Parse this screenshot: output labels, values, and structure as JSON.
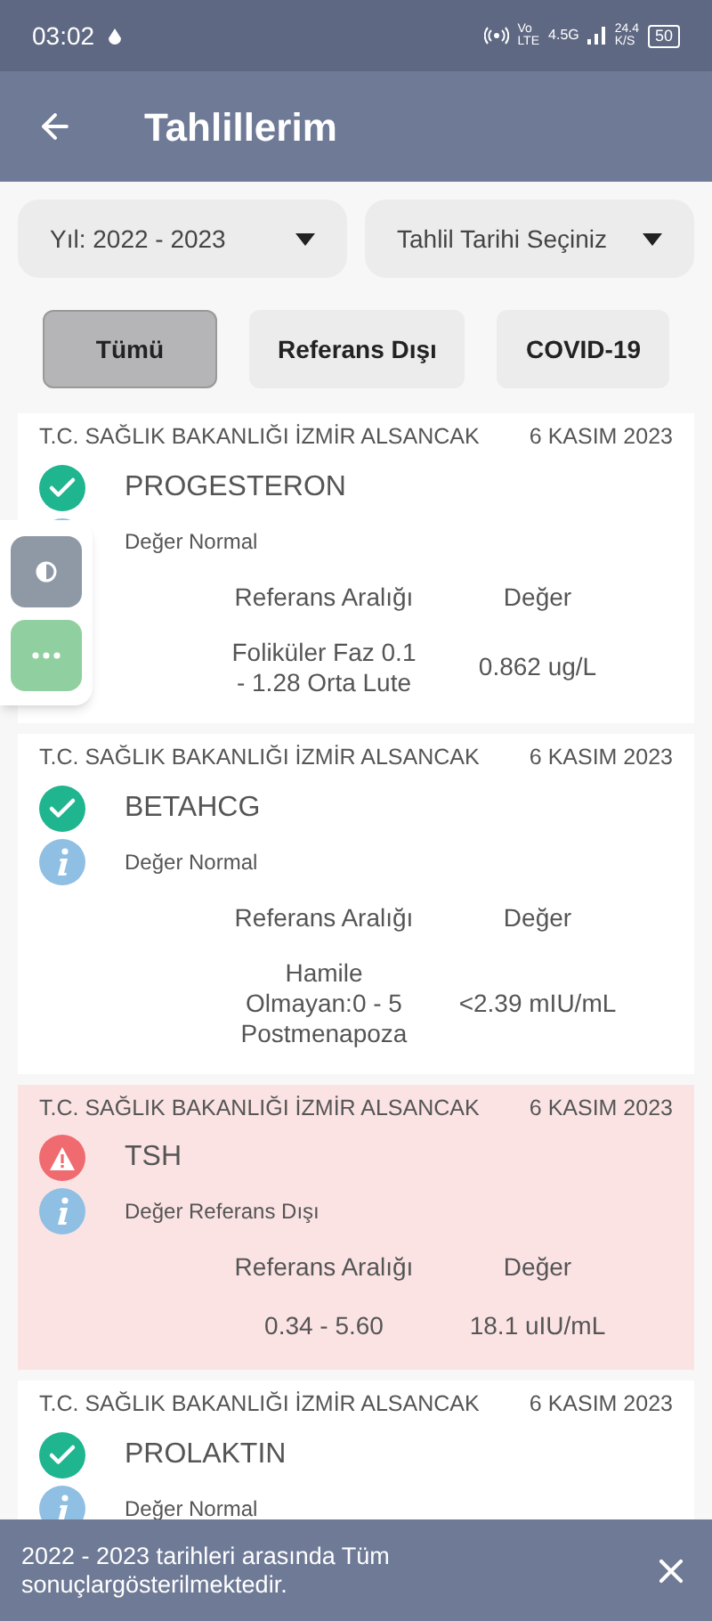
{
  "status_bar": {
    "time": "03:02",
    "volte_top": "Vo",
    "volte_bottom": "LTE",
    "network": "4.5G",
    "speed": "24.4",
    "speed_unit": "K/S",
    "battery": "50"
  },
  "header": {
    "title": "Tahlillerim"
  },
  "filters": [
    {
      "label": "Yıl: 2022 - 2023"
    },
    {
      "label": "Tahlil Tarihi Seçiniz"
    }
  ],
  "tabs": [
    {
      "label": "Tümü",
      "selected": true
    },
    {
      "label": "Referans Dışı",
      "selected": false
    },
    {
      "label": "COVID-19",
      "selected": false
    }
  ],
  "results": [
    {
      "source": "T.C. SAĞLIK BAKANLIĞI İZMİR ALSANCAK",
      "date": "6 KASIM 2023",
      "kind": "normal",
      "name": "PROGESTERON",
      "status": "Değer Normal",
      "range_header": "Referans Aralığı",
      "value_header": "Değer",
      "range": "Foliküler Faz 0.1 - 1.28 Orta Lute",
      "value": "0.862 ug/L"
    },
    {
      "source": "T.C. SAĞLIK BAKANLIĞI İZMİR ALSANCAK",
      "date": "6 KASIM 2023",
      "kind": "normal",
      "name": "BETAHCG",
      "status": "Değer Normal",
      "range_header": "Referans Aralığı",
      "value_header": "Değer",
      "range": "Hamile Olmayan:0 - 5 Postmenapoza",
      "value": "<2.39 mIU/mL"
    },
    {
      "source": "T.C. SAĞLIK BAKANLIĞI İZMİR ALSANCAK",
      "date": "6 KASIM 2023",
      "kind": "out_of_range",
      "name": "TSH",
      "status": "Değer Referans Dışı",
      "range_header": "Referans Aralığı",
      "value_header": "Değer",
      "range": "0.34 - 5.60",
      "value": "18.1 uIU/mL"
    },
    {
      "source": "T.C. SAĞLIK BAKANLIĞI İZMİR ALSANCAK",
      "date": "6 KASIM 2023",
      "kind": "normal",
      "name": "PROLAKTIN",
      "status": "Değer Normal"
    }
  ],
  "snackbar": {
    "message": "2022 - 2023 tarihleri arasında Tüm sonuçlargösterilmektedir."
  }
}
